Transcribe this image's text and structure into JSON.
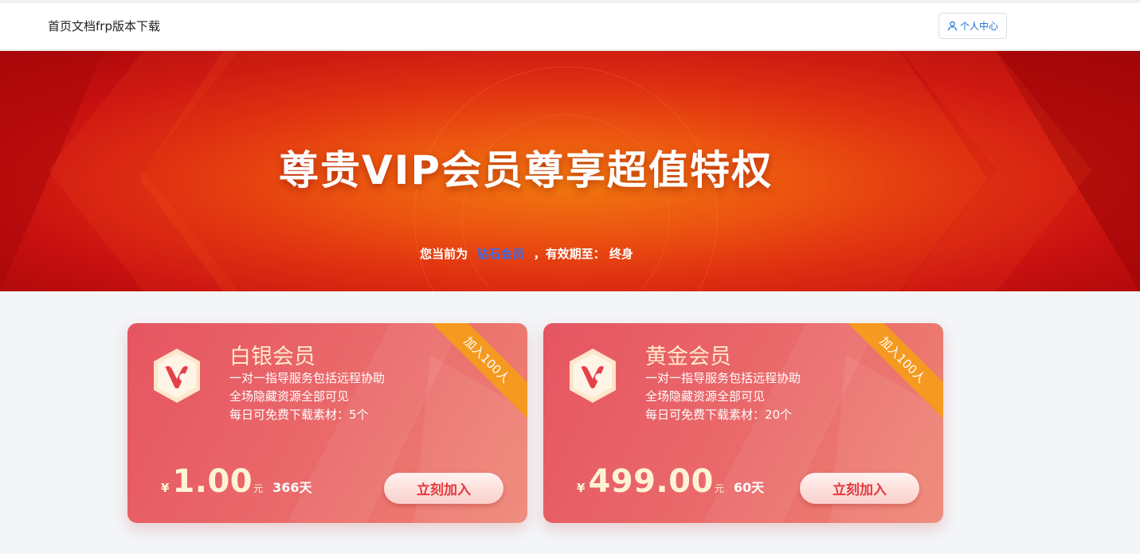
{
  "nav": {
    "items": [
      {
        "label": "首页"
      },
      {
        "label": "文档"
      },
      {
        "label": "frp版本下载"
      }
    ],
    "user_center": "个人中心",
    "user_icon": "user-icon"
  },
  "banner": {
    "title": "尊贵VIP会员尊享超值特权",
    "status_prefix": "您当前为",
    "level": "钻石会员",
    "status_suffix": "，有效期至：",
    "expiry": "终身"
  },
  "plans": [
    {
      "name": "白银会员",
      "features": [
        "一对一指导服务包括远程协助",
        "全场隐藏资源全部可见",
        "每日可免费下载素材：5个"
      ],
      "ribbon": "加入100人",
      "currency": "¥",
      "price": "1.00",
      "unit": "元",
      "days": "366天",
      "button": "立刻加入"
    },
    {
      "name": "黄金会员",
      "features": [
        "一对一指导服务包括远程协助",
        "全场隐藏资源全部可见",
        "每日可免费下载素材：20个"
      ],
      "ribbon": "加入100人",
      "currency": "¥",
      "price": "499.00",
      "unit": "元",
      "days": "60天",
      "button": "立刻加入"
    }
  ],
  "colors": {
    "accent_blue": "#1c6fd6",
    "level_blue": "#3c6ae6",
    "banner_red": "#c81010",
    "banner_orange": "#f07a0c",
    "card_red": "#e65561",
    "ribbon_orange": "#f59a21",
    "button_text": "#e4393e"
  }
}
